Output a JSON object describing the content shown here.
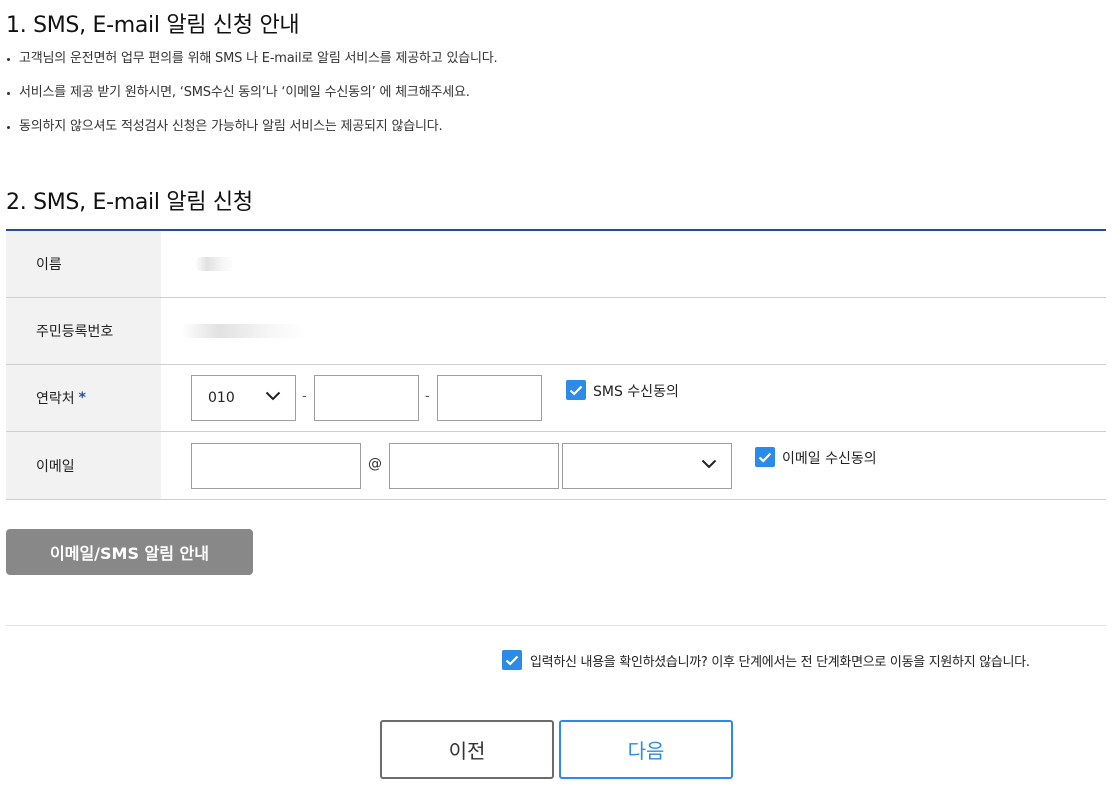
{
  "section1": {
    "title": "1. SMS, E-mail 알림 신청 안내",
    "notices": [
      "고객님의 운전면허 업무 편의를 위해 SMS 나 E-mail로 알림 서비스를 제공하고 있습니다.",
      "서비스를 제공 받기 원하시면, ‘SMS수신 동의’나 ‘이메일 수신동의’ 에 체크해주세요.",
      "동의하지 않으셔도 적성검사 신청은 가능하나 알림 서비스는 제공되지 않습니다."
    ]
  },
  "section2": {
    "title": "2. SMS, E-mail 알림 신청",
    "rows": {
      "name": {
        "label": "이름"
      },
      "rrn": {
        "label": "주민등록번호"
      },
      "phone": {
        "label": "연락처",
        "required_mark": "*",
        "prefix_value": "010",
        "separator": "-",
        "middle_value": "",
        "last_value": "",
        "sms_consent_label": "SMS 수신동의",
        "sms_consent_checked": true
      },
      "email": {
        "label": "이메일",
        "local_value": "",
        "at_sign": "@",
        "domain_value": "",
        "domain_select_value": "",
        "email_consent_label": "이메일 수신동의",
        "email_consent_checked": true
      }
    }
  },
  "guide_button_label": "이메일/SMS 알림 안내",
  "confirm": {
    "checked": true,
    "text": "입력하신 내용을 확인하셨습니까? 이후 단계에서는 전 단계화면으로 이동을 지원하지 않습니다."
  },
  "nav": {
    "prev_label": "이전",
    "next_label": "다음"
  },
  "colors": {
    "accent": "#2c8ae8",
    "header_rule": "#1f4e9a",
    "guide_button": "#888888",
    "label_bg": "#f2f2f2"
  },
  "icons": {
    "checkbox": "check-icon",
    "select": "chevron-down-icon"
  }
}
